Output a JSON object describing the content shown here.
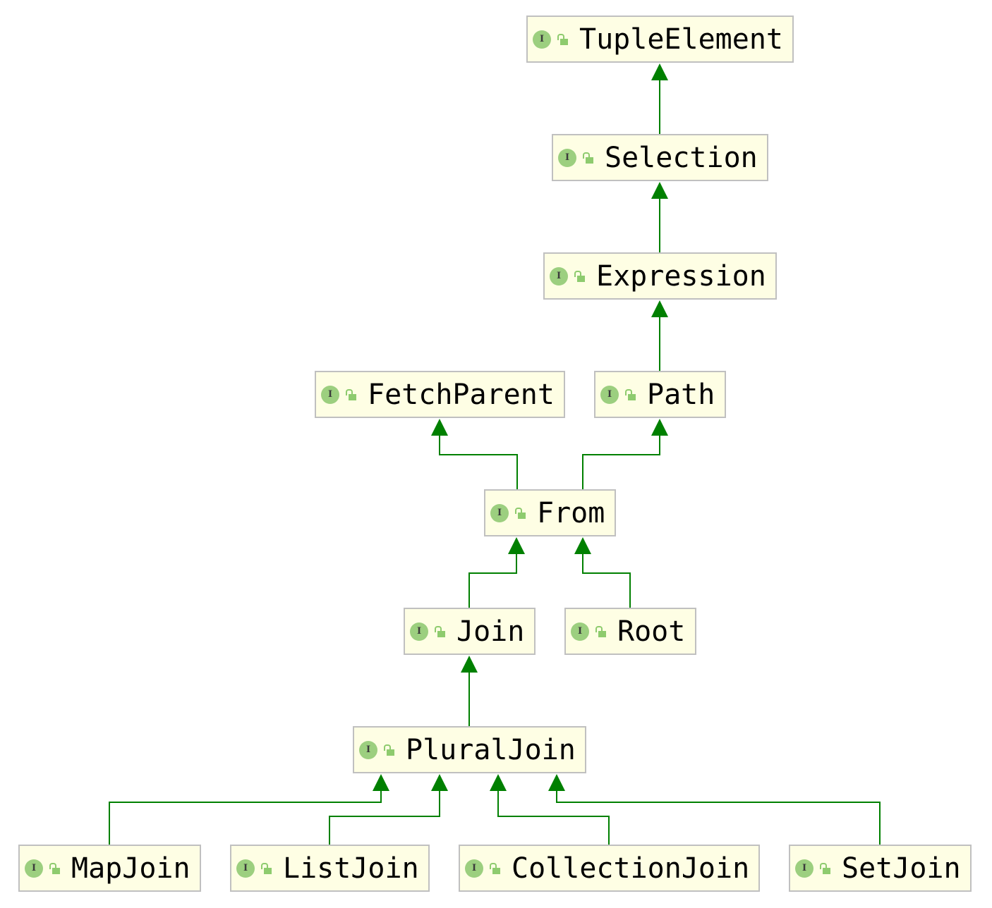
{
  "diagram": {
    "type": "class-hierarchy",
    "edge_color": "#008000",
    "node_fill": "#fefee4",
    "node_border": "#c0c0c0",
    "badge_color": "#9ccf7f",
    "nodes": [
      {
        "id": "TupleElement",
        "label": "TupleElement",
        "kind": "interface",
        "badge": "I",
        "visibility": "public"
      },
      {
        "id": "Selection",
        "label": "Selection",
        "kind": "interface",
        "badge": "I",
        "visibility": "public"
      },
      {
        "id": "Expression",
        "label": "Expression",
        "kind": "interface",
        "badge": "I",
        "visibility": "public"
      },
      {
        "id": "FetchParent",
        "label": "FetchParent",
        "kind": "interface",
        "badge": "I",
        "visibility": "public"
      },
      {
        "id": "Path",
        "label": "Path",
        "kind": "interface",
        "badge": "I",
        "visibility": "public"
      },
      {
        "id": "From",
        "label": "From",
        "kind": "interface",
        "badge": "I",
        "visibility": "public"
      },
      {
        "id": "Join",
        "label": "Join",
        "kind": "interface",
        "badge": "I",
        "visibility": "public"
      },
      {
        "id": "Root",
        "label": "Root",
        "kind": "interface",
        "badge": "I",
        "visibility": "public"
      },
      {
        "id": "PluralJoin",
        "label": "PluralJoin",
        "kind": "interface",
        "badge": "I",
        "visibility": "public"
      },
      {
        "id": "MapJoin",
        "label": "MapJoin",
        "kind": "interface",
        "badge": "I",
        "visibility": "public"
      },
      {
        "id": "ListJoin",
        "label": "ListJoin",
        "kind": "interface",
        "badge": "I",
        "visibility": "public"
      },
      {
        "id": "CollectionJoin",
        "label": "CollectionJoin",
        "kind": "interface",
        "badge": "I",
        "visibility": "public"
      },
      {
        "id": "SetJoin",
        "label": "SetJoin",
        "kind": "interface",
        "badge": "I",
        "visibility": "public"
      }
    ],
    "edges": [
      {
        "from": "Selection",
        "to": "TupleElement",
        "relation": "extends"
      },
      {
        "from": "Expression",
        "to": "Selection",
        "relation": "extends"
      },
      {
        "from": "Path",
        "to": "Expression",
        "relation": "extends"
      },
      {
        "from": "From",
        "to": "FetchParent",
        "relation": "extends"
      },
      {
        "from": "From",
        "to": "Path",
        "relation": "extends"
      },
      {
        "from": "Join",
        "to": "From",
        "relation": "extends"
      },
      {
        "from": "Root",
        "to": "From",
        "relation": "extends"
      },
      {
        "from": "PluralJoin",
        "to": "Join",
        "relation": "extends"
      },
      {
        "from": "MapJoin",
        "to": "PluralJoin",
        "relation": "extends"
      },
      {
        "from": "ListJoin",
        "to": "PluralJoin",
        "relation": "extends"
      },
      {
        "from": "CollectionJoin",
        "to": "PluralJoin",
        "relation": "extends"
      },
      {
        "from": "SetJoin",
        "to": "PluralJoin",
        "relation": "extends"
      }
    ]
  }
}
